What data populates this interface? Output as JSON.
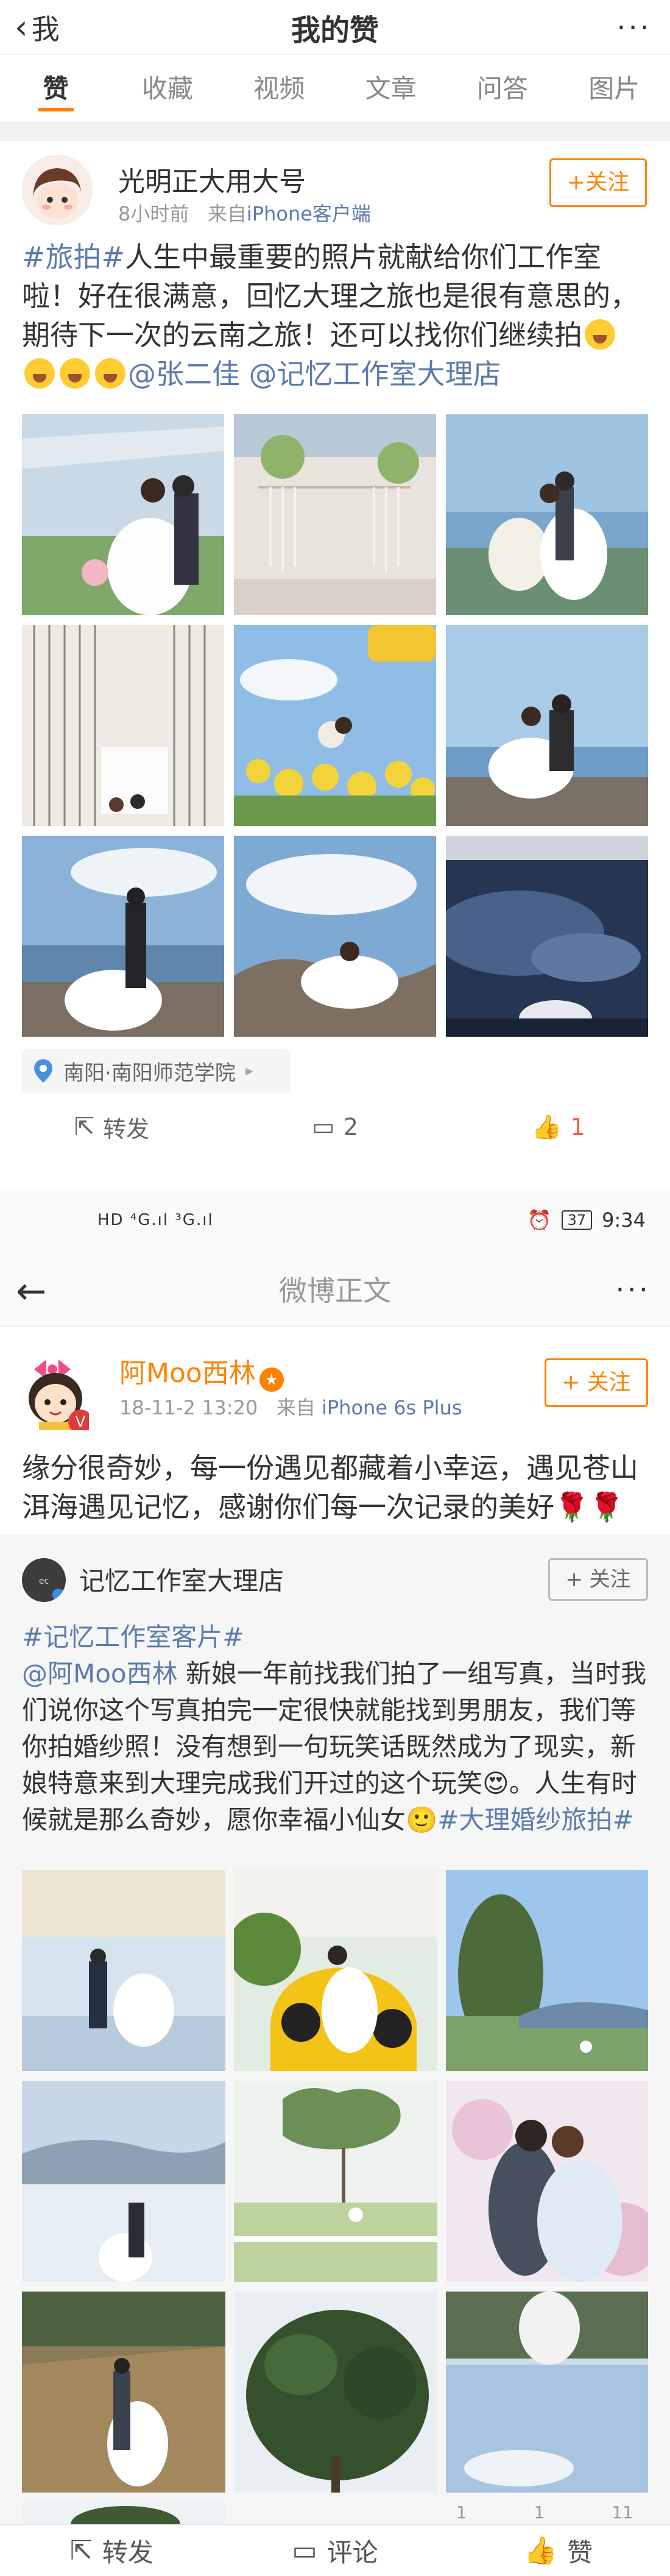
{
  "header": {
    "back_label": "我",
    "title": "我的赞",
    "more": "···"
  },
  "tabs": [
    {
      "label": "赞",
      "active": true
    },
    {
      "label": "收藏"
    },
    {
      "label": "视频"
    },
    {
      "label": "文章"
    },
    {
      "label": "问答"
    },
    {
      "label": "图片"
    }
  ],
  "post1": {
    "username": "光明正大用大号",
    "time": "8小时前",
    "source_prefix": "来自",
    "source": "iPhone客户端",
    "follow": "+关注",
    "text_tag": "#旅拍#",
    "text_main": "人生中最重要的照片就献给你们工作室啦！好在很满意，回忆大理之旅也是很有意思的，期待下一次的云南之旅！还可以找你们继续拍",
    "mention1": "@张二佳",
    "mention2": "@记忆工作室大理店",
    "location": "南阳·南阳师范学院",
    "actions": {
      "repost": "转发",
      "comment": "2",
      "like": "1"
    }
  },
  "status_bar": {
    "signal": "HD ⁴G.ıl ³G.ıl",
    "battery": "37",
    "time": "9:34"
  },
  "detail_nav": {
    "title": "微博正文",
    "more": "···"
  },
  "post2": {
    "username": "阿Moo西林",
    "time": "18-11-2 13:20",
    "source_prefix": "来自",
    "source": "iPhone 6s Plus",
    "follow": "+ 关注",
    "text": "缘分很奇妙，每一份遇见都藏着小幸运，遇见苍山洱海遇见记忆，感谢你们每一次记录的美好🌹🌹"
  },
  "repost": {
    "username": "记忆工作室大理店",
    "follow": "+ 关注",
    "tag1": "#记忆工作室客片#",
    "mention": "@阿Moo西林",
    "text1": " 新娘一年前找我们拍了一组写真，当时我们说你这个写真拍完一定很快就能找到男朋友，我们等你拍婚纱照！没有想到一句玩笑话既然成为了现实，新娘特意来到大理完成我们开过的这个玩笑😍。人生有时候就是那么奇妙，愿你幸福小仙女🙂",
    "tag2": "#大理婚纱旅拍#",
    "mini_actions": {
      "repost": "1",
      "comment": "1",
      "like": "11"
    }
  },
  "bottom_bar": {
    "repost": "转发",
    "comment": "评论",
    "like": "赞"
  },
  "colors": {
    "accent": "#ff8200",
    "link": "#5b7bac",
    "text": "#333333",
    "muted": "#999999"
  }
}
